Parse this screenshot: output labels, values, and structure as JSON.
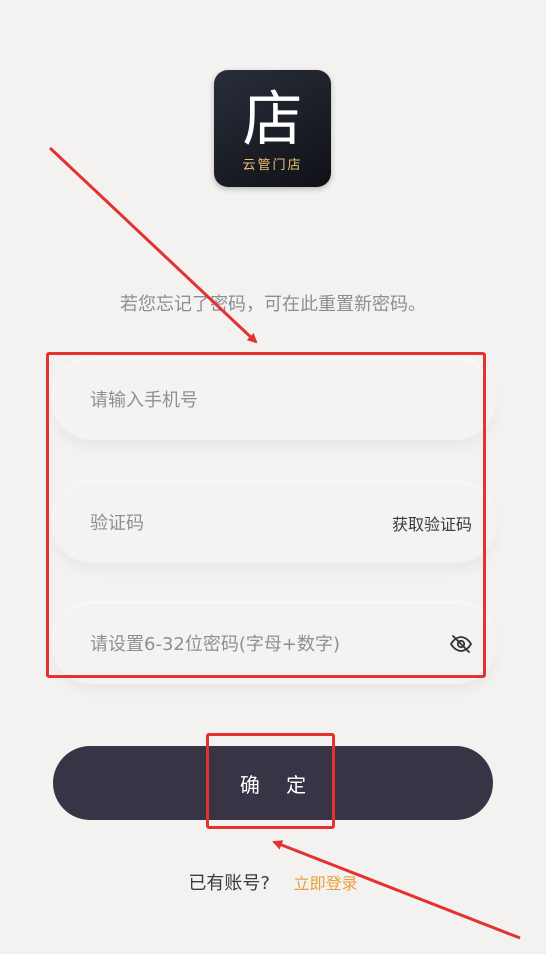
{
  "logo": {
    "glyph": "店",
    "subtitle": "云管门店"
  },
  "hint": "若您忘记了密码，可在此重置新密码。",
  "form": {
    "phone_placeholder": "请输入手机号",
    "code_placeholder": "验证码",
    "get_code_label": "获取验证码",
    "password_placeholder": "请设置6-32位密码(字母+数字)",
    "password_toggle_icon": "eye-off-icon"
  },
  "confirm_label": "确 定",
  "footer": {
    "has_account": "已有账号?",
    "login_link": "立即登录"
  },
  "colors": {
    "background": "#f3f2f1",
    "button": "#383445",
    "link": "#e9a23b",
    "annotation": "#e3322f",
    "logo_sub": "#e9c16b"
  }
}
